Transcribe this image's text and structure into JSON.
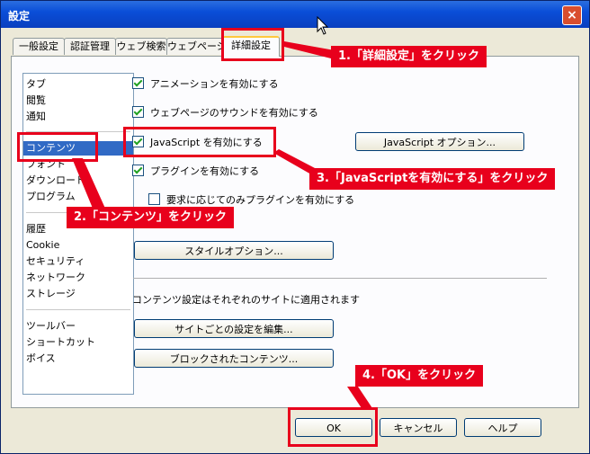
{
  "window": {
    "title": "設定",
    "close": "×"
  },
  "tabs": [
    "一般設定",
    "認証管理",
    "ウェブ検索",
    "ウェブページ",
    "詳細設定"
  ],
  "categories": {
    "group1": [
      "タブ",
      "閲覧",
      "通知"
    ],
    "group2": [
      "コンテンツ",
      "フォント",
      "ダウンロード",
      "プログラム"
    ],
    "group3": [
      "履歴",
      "Cookie",
      "セキュリティ",
      "ネットワーク",
      "ストレージ"
    ],
    "group4": [
      "ツールバー",
      "ショートカット",
      "ボイス"
    ]
  },
  "content": {
    "animation": "アニメーションを有効にする",
    "sound": "ウェブページのサウンドを有効にする",
    "javascript": "JavaScript を有効にする",
    "js_options": "JavaScript オプション...",
    "plugins": "プラグインを有効にする",
    "plugins_on_demand": "要求に応じてのみプラグインを有効にする",
    "style_options": "スタイルオプション...",
    "site_note": "コンテンツ設定はそれぞれのサイトに適用されます",
    "edit_site_prefs": "サイトごとの設定を編集...",
    "blocked_content": "ブロックされたコンテンツ..."
  },
  "buttons": {
    "ok": "OK",
    "cancel": "キャンセル",
    "help": "ヘルプ"
  },
  "annotations": {
    "step1": "1.「詳細設定」をクリック",
    "step2": "2.「コンテンツ」をクリック",
    "step3": "3.「JavaScriptを有効にする」をクリック",
    "step4": "4.「OK」をクリック"
  },
  "colors": {
    "highlight": "#e8001c",
    "selection": "#316ac5",
    "titlebar": "#0a4ed8"
  }
}
